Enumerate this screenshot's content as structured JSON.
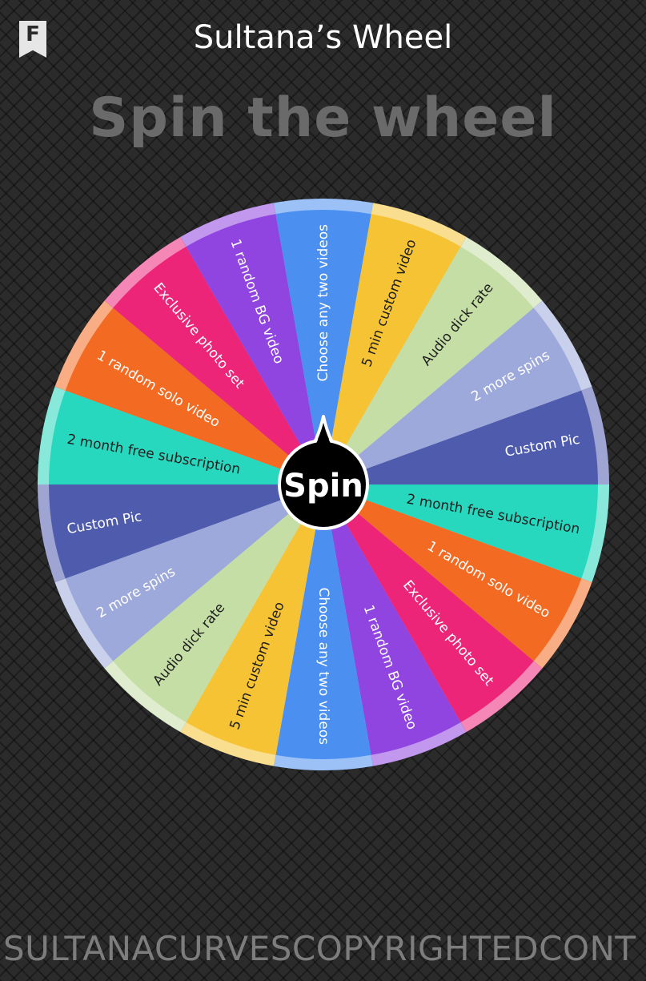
{
  "header": {
    "badge_letter": "F",
    "title": "Sultana’s Wheel"
  },
  "heading": "Spin the wheel",
  "spin_button": {
    "label": "Spin"
  },
  "wheel": {
    "segments": [
      {
        "label": "5 min custom video",
        "color": "#f6c335"
      },
      {
        "label": "Audio dick rate",
        "color": "#c5dea6"
      },
      {
        "label": "2 more spins",
        "color": "#9da9da"
      },
      {
        "label": "Custom Pic",
        "color": "#4f5cae"
      },
      {
        "label": "2 month free subscription",
        "color": "#27d8be"
      },
      {
        "label": "1 random solo video",
        "color": "#f36a22"
      },
      {
        "label": "Exclusive photo set",
        "color": "#ec2578"
      },
      {
        "label": "1 random BG video",
        "color": "#9044e0"
      },
      {
        "label": "Choose any two videos",
        "color": "#4b8ff0"
      },
      {
        "label": "5 min custom video",
        "color": "#f6c335"
      },
      {
        "label": "Audio dick rate",
        "color": "#c5dea6"
      },
      {
        "label": "2 more spins",
        "color": "#9da9da"
      },
      {
        "label": "Custom Pic",
        "color": "#4f5cae"
      },
      {
        "label": "2 month free subscription",
        "color": "#27d8be"
      },
      {
        "label": "1 random solo video",
        "color": "#f36a22"
      },
      {
        "label": "Exclusive photo set",
        "color": "#ec2578"
      },
      {
        "label": "1 random BG video",
        "color": "#9044e0"
      },
      {
        "label": "Choose any two videos",
        "color": "#4b8ff0"
      }
    ],
    "dark_text_colors": [
      "#f6c335",
      "#c5dea6",
      "#27d8be"
    ]
  },
  "footer": {
    "watermark": "SULTANACURVESCOPYRIGHTEDCONT"
  }
}
